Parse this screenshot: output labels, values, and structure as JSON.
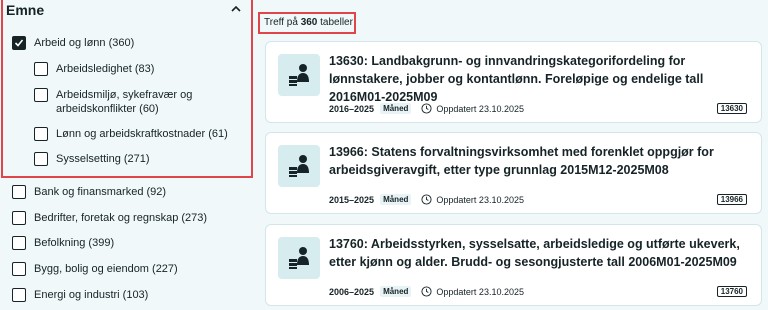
{
  "filter": {
    "header": "Emne",
    "parent": {
      "label": "Arbeid og lønn (360)",
      "checked": true
    },
    "children": [
      {
        "label": "Arbeidsledighet (83)"
      },
      {
        "label": "Arbeidsmiljø, sykefravær og arbeidskonflikter (60)"
      },
      {
        "label": "Lønn og arbeidskraftkostnader (61)"
      },
      {
        "label": "Sysselsetting (271)"
      }
    ],
    "others": [
      {
        "label": "Bank og finansmarked (92)"
      },
      {
        "label": "Bedrifter, foretak og regnskap (273)"
      },
      {
        "label": "Befolkning (399)"
      },
      {
        "label": "Bygg, bolig og eiendom (227)"
      },
      {
        "label": "Energi og industri (103)"
      }
    ]
  },
  "results": {
    "prefix": "Treff på ",
    "count": "360",
    "suffix": " tabeller"
  },
  "cards": [
    {
      "title": "13630: Landbakgrunn- og innvandringskategorifordeling for lønnstakere, jobber og kontantlønn. Foreløpige og endelige tall 2016M01-2025M09",
      "years": "2016–2025",
      "freq": "Måned",
      "updated": "Oppdatert 23.10.2025",
      "code": "13630"
    },
    {
      "title": "13966: Statens forvaltningsvirksomhet med forenklet oppgjør for arbeidsgiveravgift, etter type grunnlag 2015M12-2025M08",
      "years": "2015–2025",
      "freq": "Måned",
      "updated": "Oppdatert 23.10.2025",
      "code": "13966"
    },
    {
      "title": "13760: Arbeidsstyrken, sysselsatte, arbeidsledige og utførte ukeverk, etter kjønn og alder. Brudd- og sesongjusterte tall 2006M01-2025M09",
      "years": "2006–2025",
      "freq": "Måned",
      "updated": "Oppdatert 23.10.2025",
      "code": "13760"
    }
  ]
}
